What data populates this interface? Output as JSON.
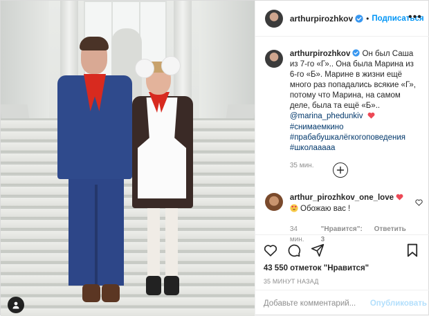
{
  "post": {
    "author": {
      "username": "arthurpirozhkov",
      "verified": true,
      "follow_label": "Подписаться",
      "more_icon": "more-horizontal-icon"
    },
    "caption": {
      "username": "arthurpirozhkov",
      "text": " Он был Саша из 7-го «Г».. Она была Марина из 6-го «Б». Марине в жизни ещё много раз попадались всякие «Г», потому что Марина, на самом деле, была та ещё «Б».. ",
      "mention": "@marina_phedunkiv",
      "emoji": "heart",
      "hashtags": [
        "#снимаемкино",
        "#прабабушкалёгкогоповедения",
        "#школааааа"
      ],
      "time": "35 мин."
    },
    "load_more_icon": "plus-circle-icon",
    "comment": {
      "username": "arthur_pirozhkov_one_love",
      "emoji_heart": "heart",
      "emoji_face": "heart-eyes",
      "text": " Обожаю вас !",
      "time": "34 мин.",
      "likes_label": "\"Нравится\": 3",
      "reply_label": "Ответить"
    },
    "actions": {
      "likes": "43 550 отметок \"Нравится\"",
      "date": "35 МИНУТ НАЗАД"
    },
    "add_comment": {
      "placeholder": "Добавьте комментарий...",
      "publish_label": "Опубликовать"
    },
    "colors": {
      "accent": "#0095f6",
      "link": "#00376b",
      "heart": "#ed4956",
      "publish_disabled": "#b2dffc"
    }
  }
}
